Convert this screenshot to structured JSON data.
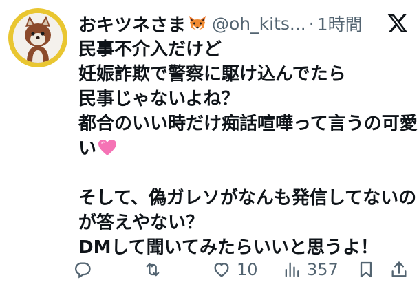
{
  "tweet": {
    "display_name": "おキツネさま",
    "name_emoji": "fox-emoji",
    "handle": "@oh_kits...",
    "separator": "·",
    "timestamp": "1時間",
    "body_lines": [
      "民事不介入だけど",
      "妊娠詐欺で警察に駆け込んでたら",
      "民事じゃないよね？",
      "都合のいい時だけ痴話喧嘩って言うの可愛",
      "い",
      "",
      "そして、偽ガレソがなんも発信してないの",
      "が答えやない？",
      "DMして聞いてみたらいいと思うよ！"
    ],
    "inline_emoji": "pink-heart-emoji"
  },
  "actions": {
    "reply": {
      "icon": "reply-icon"
    },
    "repost": {
      "icon": "repost-icon"
    },
    "like": {
      "icon": "heart-icon",
      "count": "10"
    },
    "views": {
      "icon": "views-icon",
      "count": "357"
    },
    "bookmark": {
      "icon": "bookmark-icon"
    },
    "share": {
      "icon": "share-icon"
    }
  },
  "colors": {
    "text": "#0f1419",
    "secondary": "#536471",
    "avatar_ring": "#e9c631"
  }
}
